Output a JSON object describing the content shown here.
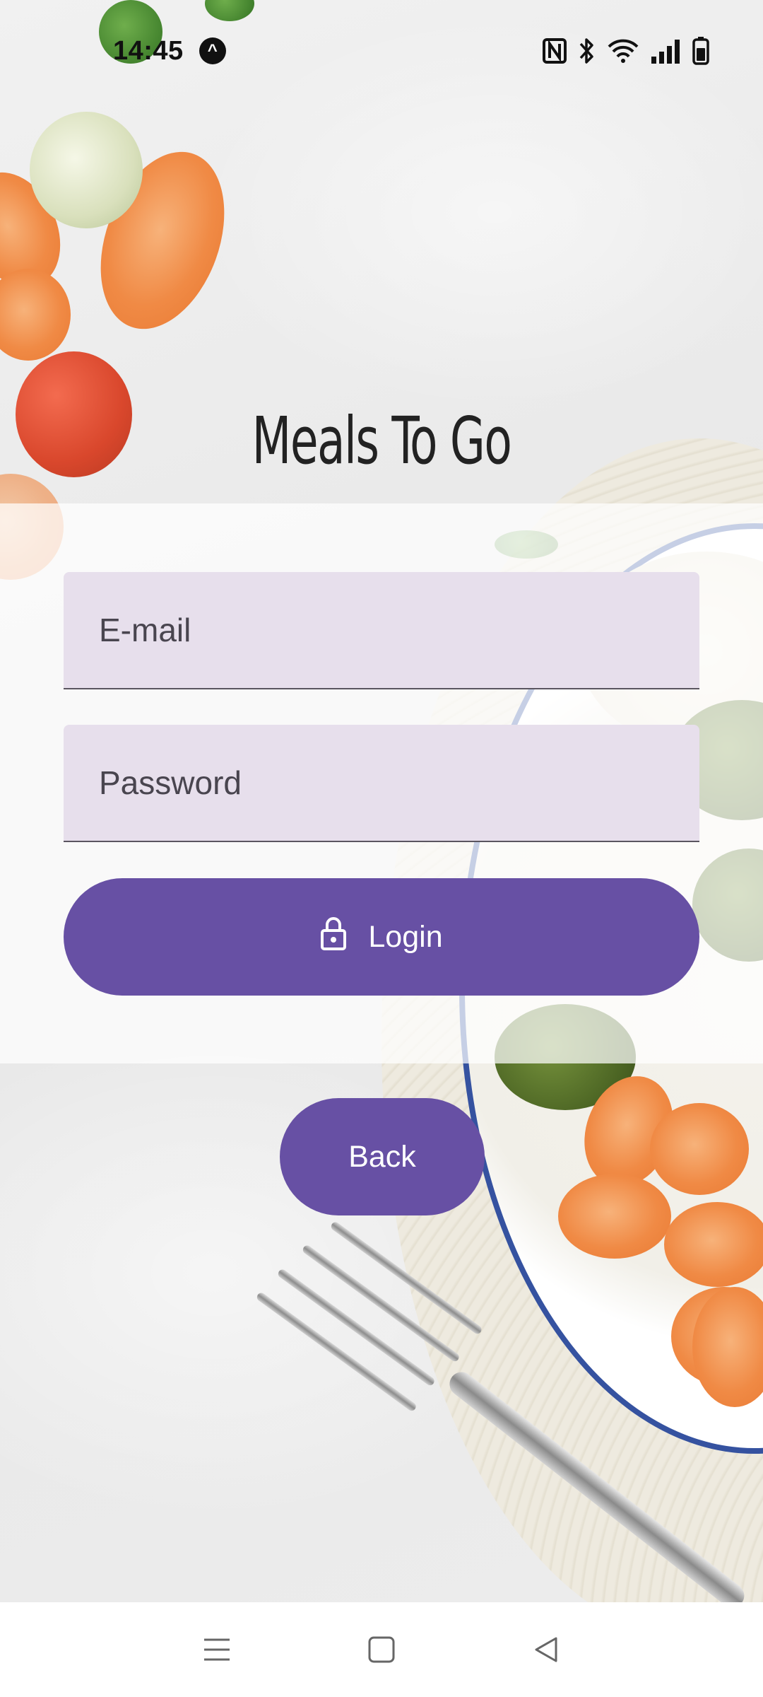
{
  "status_bar": {
    "time": "14:45",
    "icons": [
      "app-notification-icon",
      "nfc-icon",
      "bluetooth-icon",
      "wifi-icon",
      "signal-icon",
      "battery-icon"
    ]
  },
  "app": {
    "title": "Meals To Go"
  },
  "login_form": {
    "email_placeholder": "E-mail",
    "password_placeholder": "Password",
    "login_label": "Login",
    "login_icon": "lock-open-icon",
    "back_label": "Back"
  },
  "nav_bar": {
    "buttons": [
      "menu-icon",
      "home-icon",
      "back-icon"
    ]
  },
  "colors": {
    "primary": "#6750a4",
    "field_bg": "#e7dfec",
    "panel_overlay": "rgba(255,255,255,0.72)"
  }
}
